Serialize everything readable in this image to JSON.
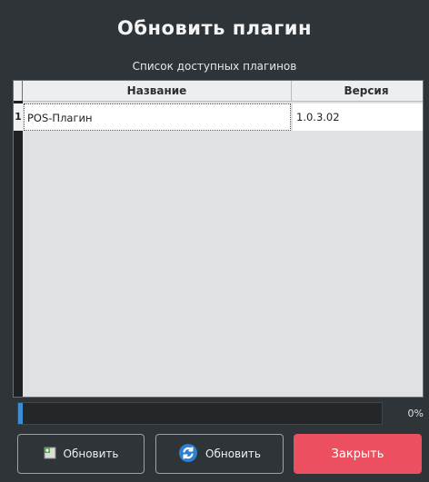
{
  "dialog": {
    "title": "Обновить плагин",
    "subtitle": "Список доступных плагинов"
  },
  "table": {
    "columns": [
      "Название",
      "Версия"
    ],
    "rows": [
      {
        "num": "1",
        "name": "POS-Плагин",
        "version": "1.0.3.02"
      }
    ]
  },
  "progress": {
    "value": 0,
    "text": "0%"
  },
  "buttons": {
    "update_local": "Обновить",
    "update_remote": "Обновить",
    "close": "Закрыть"
  },
  "colors": {
    "background": "#2f3438",
    "close_button": "#ec5060",
    "progress_fill": "#3d8ed4"
  },
  "icons": {
    "update_local": "install-package-icon",
    "update_remote": "refresh-icon"
  }
}
